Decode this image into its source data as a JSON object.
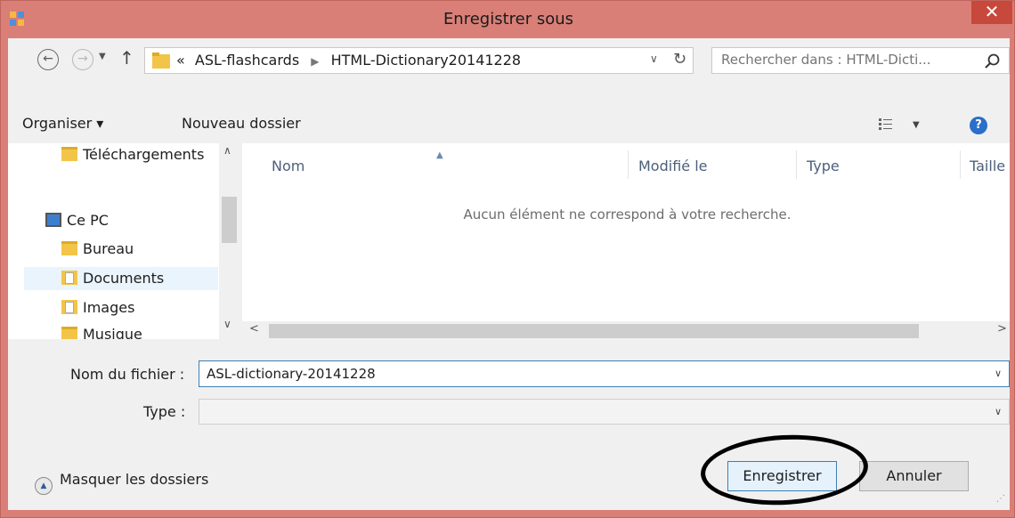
{
  "window": {
    "title": "Enregistrer sous",
    "close_glyph": "✕"
  },
  "nav": {
    "back_icon": "back-arrow-icon",
    "forward_icon": "forward-arrow-icon",
    "up_icon": "up-arrow-icon",
    "breadcrumb_prefix": "«",
    "breadcrumb": [
      "ASL-flashcards",
      "HTML-Dictionary20141228"
    ]
  },
  "search": {
    "placeholder": "Rechercher dans : HTML-Dicti..."
  },
  "toolbar": {
    "organize_label": "Organiser ▾",
    "new_folder_label": "Nouveau dossier"
  },
  "sidebar": {
    "items": [
      {
        "label": "Téléchargements",
        "icon": "downloads-folder-icon"
      },
      {
        "label": "Ce PC",
        "icon": "computer-icon"
      },
      {
        "label": "Bureau",
        "icon": "desktop-folder-icon"
      },
      {
        "label": "Documents",
        "icon": "documents-folder-icon",
        "selected": true
      },
      {
        "label": "Images",
        "icon": "images-folder-icon"
      },
      {
        "label": "Musique",
        "icon": "music-folder-icon"
      }
    ]
  },
  "file_list": {
    "columns": [
      "Nom",
      "Modifié le",
      "Type",
      "Taille"
    ],
    "empty_message": "Aucun élément ne correspond à votre recherche."
  },
  "form": {
    "filename_label": "Nom du fichier :",
    "filename_value": "ASL-dictionary-20141228",
    "type_label": "Type :",
    "type_value": ""
  },
  "footer": {
    "hide_folders_label": "Masquer les dossiers",
    "save_label": "Enregistrer",
    "cancel_label": "Annuler"
  },
  "colors": {
    "title_bar": "#d97f77",
    "close_button": "#c7493b",
    "accent_border": "#3c7fb1"
  }
}
